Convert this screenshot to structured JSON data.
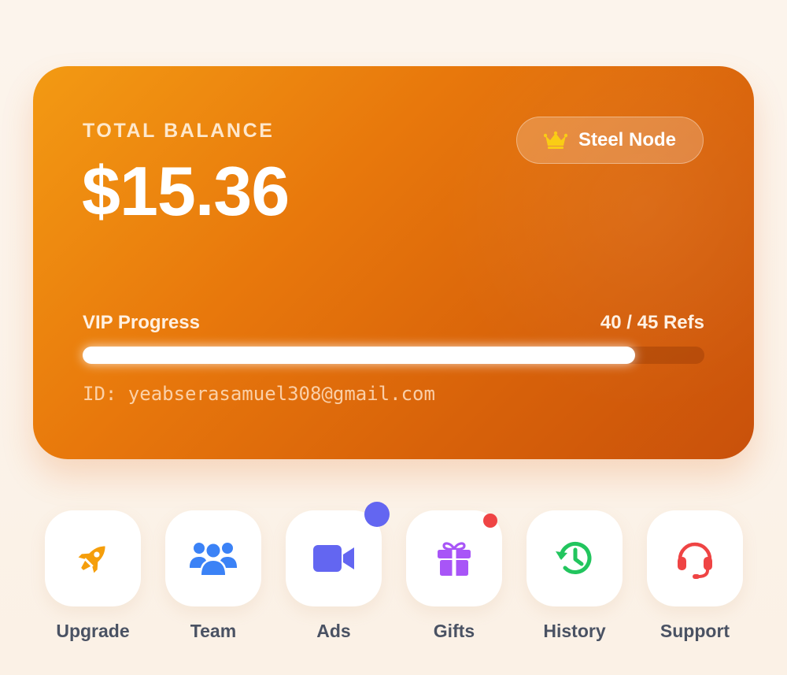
{
  "balance_card": {
    "label": "TOTAL BALANCE",
    "amount": "$15.36",
    "tier": {
      "label": "Steel Node",
      "icon": "crown-icon",
      "icon_color": "#facc15"
    },
    "vip_progress": {
      "label": "VIP Progress",
      "count_text": "40 / 45 Refs",
      "current": 40,
      "target": 45
    },
    "user_id": "ID: yeabserasamuel308@gmail.com"
  },
  "quick_actions": [
    {
      "label": "Upgrade",
      "icon": "rocket-icon",
      "color": "#f59e0b"
    },
    {
      "label": "Team",
      "icon": "users-icon",
      "color": "#3b82f6"
    },
    {
      "label": "Ads",
      "icon": "video-camera-icon",
      "color": "#6366f1",
      "badge": "indicator"
    },
    {
      "label": "Gifts",
      "icon": "gift-icon",
      "color": "#a855f7",
      "badge": "indicator"
    },
    {
      "label": "History",
      "icon": "history-icon",
      "color": "#22c55e"
    },
    {
      "label": "Support",
      "icon": "headset-icon",
      "color": "#ef4444"
    }
  ],
  "colors": {
    "card_gradient_start": "#f39a13",
    "card_gradient_end": "#c9510b",
    "background": "#fcf3ea",
    "label_text": "#4a5263"
  }
}
